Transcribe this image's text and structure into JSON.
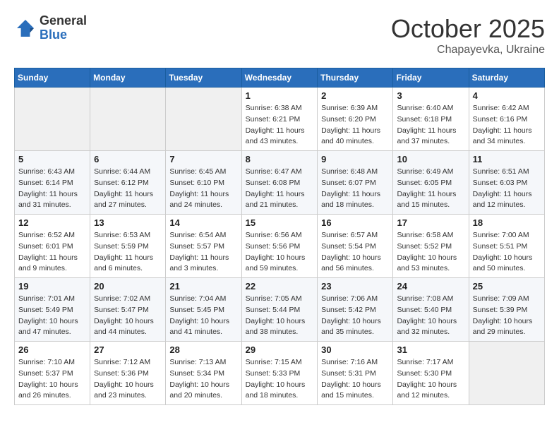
{
  "logo": {
    "general": "General",
    "blue": "Blue"
  },
  "title": "October 2025",
  "subtitle": "Chapayevka, Ukraine",
  "days_header": [
    "Sunday",
    "Monday",
    "Tuesday",
    "Wednesday",
    "Thursday",
    "Friday",
    "Saturday"
  ],
  "weeks": [
    [
      {
        "day": "",
        "sunrise": "",
        "sunset": "",
        "daylight": ""
      },
      {
        "day": "",
        "sunrise": "",
        "sunset": "",
        "daylight": ""
      },
      {
        "day": "",
        "sunrise": "",
        "sunset": "",
        "daylight": ""
      },
      {
        "day": "1",
        "sunrise": "Sunrise: 6:38 AM",
        "sunset": "Sunset: 6:21 PM",
        "daylight": "Daylight: 11 hours and 43 minutes."
      },
      {
        "day": "2",
        "sunrise": "Sunrise: 6:39 AM",
        "sunset": "Sunset: 6:20 PM",
        "daylight": "Daylight: 11 hours and 40 minutes."
      },
      {
        "day": "3",
        "sunrise": "Sunrise: 6:40 AM",
        "sunset": "Sunset: 6:18 PM",
        "daylight": "Daylight: 11 hours and 37 minutes."
      },
      {
        "day": "4",
        "sunrise": "Sunrise: 6:42 AM",
        "sunset": "Sunset: 6:16 PM",
        "daylight": "Daylight: 11 hours and 34 minutes."
      }
    ],
    [
      {
        "day": "5",
        "sunrise": "Sunrise: 6:43 AM",
        "sunset": "Sunset: 6:14 PM",
        "daylight": "Daylight: 11 hours and 31 minutes."
      },
      {
        "day": "6",
        "sunrise": "Sunrise: 6:44 AM",
        "sunset": "Sunset: 6:12 PM",
        "daylight": "Daylight: 11 hours and 27 minutes."
      },
      {
        "day": "7",
        "sunrise": "Sunrise: 6:45 AM",
        "sunset": "Sunset: 6:10 PM",
        "daylight": "Daylight: 11 hours and 24 minutes."
      },
      {
        "day": "8",
        "sunrise": "Sunrise: 6:47 AM",
        "sunset": "Sunset: 6:08 PM",
        "daylight": "Daylight: 11 hours and 21 minutes."
      },
      {
        "day": "9",
        "sunrise": "Sunrise: 6:48 AM",
        "sunset": "Sunset: 6:07 PM",
        "daylight": "Daylight: 11 hours and 18 minutes."
      },
      {
        "day": "10",
        "sunrise": "Sunrise: 6:49 AM",
        "sunset": "Sunset: 6:05 PM",
        "daylight": "Daylight: 11 hours and 15 minutes."
      },
      {
        "day": "11",
        "sunrise": "Sunrise: 6:51 AM",
        "sunset": "Sunset: 6:03 PM",
        "daylight": "Daylight: 11 hours and 12 minutes."
      }
    ],
    [
      {
        "day": "12",
        "sunrise": "Sunrise: 6:52 AM",
        "sunset": "Sunset: 6:01 PM",
        "daylight": "Daylight: 11 hours and 9 minutes."
      },
      {
        "day": "13",
        "sunrise": "Sunrise: 6:53 AM",
        "sunset": "Sunset: 5:59 PM",
        "daylight": "Daylight: 11 hours and 6 minutes."
      },
      {
        "day": "14",
        "sunrise": "Sunrise: 6:54 AM",
        "sunset": "Sunset: 5:57 PM",
        "daylight": "Daylight: 11 hours and 3 minutes."
      },
      {
        "day": "15",
        "sunrise": "Sunrise: 6:56 AM",
        "sunset": "Sunset: 5:56 PM",
        "daylight": "Daylight: 10 hours and 59 minutes."
      },
      {
        "day": "16",
        "sunrise": "Sunrise: 6:57 AM",
        "sunset": "Sunset: 5:54 PM",
        "daylight": "Daylight: 10 hours and 56 minutes."
      },
      {
        "day": "17",
        "sunrise": "Sunrise: 6:58 AM",
        "sunset": "Sunset: 5:52 PM",
        "daylight": "Daylight: 10 hours and 53 minutes."
      },
      {
        "day": "18",
        "sunrise": "Sunrise: 7:00 AM",
        "sunset": "Sunset: 5:51 PM",
        "daylight": "Daylight: 10 hours and 50 minutes."
      }
    ],
    [
      {
        "day": "19",
        "sunrise": "Sunrise: 7:01 AM",
        "sunset": "Sunset: 5:49 PM",
        "daylight": "Daylight: 10 hours and 47 minutes."
      },
      {
        "day": "20",
        "sunrise": "Sunrise: 7:02 AM",
        "sunset": "Sunset: 5:47 PM",
        "daylight": "Daylight: 10 hours and 44 minutes."
      },
      {
        "day": "21",
        "sunrise": "Sunrise: 7:04 AM",
        "sunset": "Sunset: 5:45 PM",
        "daylight": "Daylight: 10 hours and 41 minutes."
      },
      {
        "day": "22",
        "sunrise": "Sunrise: 7:05 AM",
        "sunset": "Sunset: 5:44 PM",
        "daylight": "Daylight: 10 hours and 38 minutes."
      },
      {
        "day": "23",
        "sunrise": "Sunrise: 7:06 AM",
        "sunset": "Sunset: 5:42 PM",
        "daylight": "Daylight: 10 hours and 35 minutes."
      },
      {
        "day": "24",
        "sunrise": "Sunrise: 7:08 AM",
        "sunset": "Sunset: 5:40 PM",
        "daylight": "Daylight: 10 hours and 32 minutes."
      },
      {
        "day": "25",
        "sunrise": "Sunrise: 7:09 AM",
        "sunset": "Sunset: 5:39 PM",
        "daylight": "Daylight: 10 hours and 29 minutes."
      }
    ],
    [
      {
        "day": "26",
        "sunrise": "Sunrise: 7:10 AM",
        "sunset": "Sunset: 5:37 PM",
        "daylight": "Daylight: 10 hours and 26 minutes."
      },
      {
        "day": "27",
        "sunrise": "Sunrise: 7:12 AM",
        "sunset": "Sunset: 5:36 PM",
        "daylight": "Daylight: 10 hours and 23 minutes."
      },
      {
        "day": "28",
        "sunrise": "Sunrise: 7:13 AM",
        "sunset": "Sunset: 5:34 PM",
        "daylight": "Daylight: 10 hours and 20 minutes."
      },
      {
        "day": "29",
        "sunrise": "Sunrise: 7:15 AM",
        "sunset": "Sunset: 5:33 PM",
        "daylight": "Daylight: 10 hours and 18 minutes."
      },
      {
        "day": "30",
        "sunrise": "Sunrise: 7:16 AM",
        "sunset": "Sunset: 5:31 PM",
        "daylight": "Daylight: 10 hours and 15 minutes."
      },
      {
        "day": "31",
        "sunrise": "Sunrise: 7:17 AM",
        "sunset": "Sunset: 5:30 PM",
        "daylight": "Daylight: 10 hours and 12 minutes."
      },
      {
        "day": "",
        "sunrise": "",
        "sunset": "",
        "daylight": ""
      }
    ]
  ]
}
